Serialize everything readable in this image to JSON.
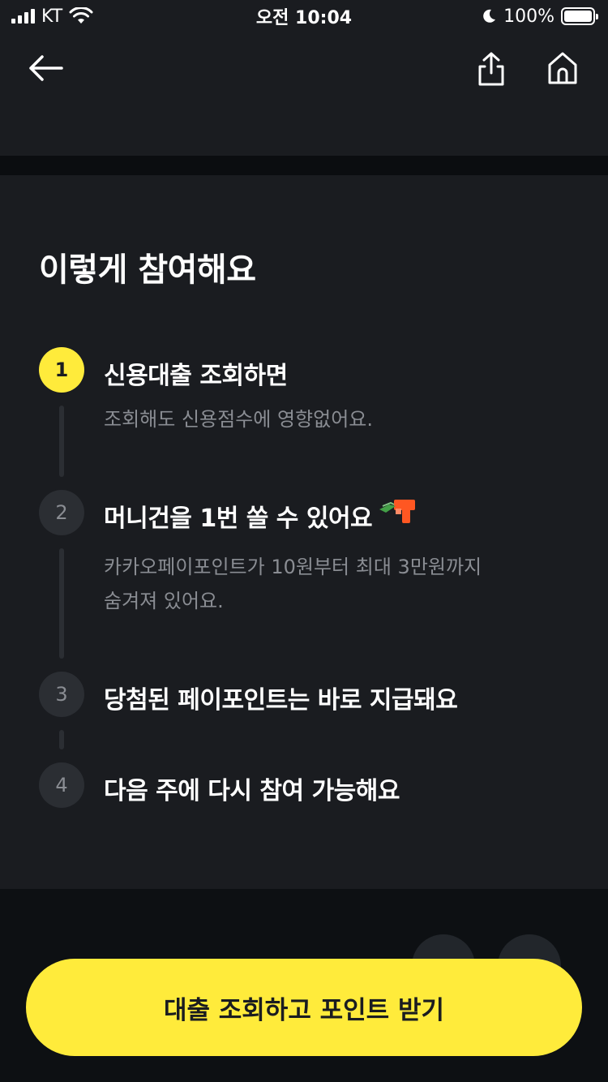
{
  "status_bar": {
    "carrier": "KT",
    "time": "오전 10:04",
    "battery": "100%",
    "icons": [
      "signal-icon",
      "wifi-icon",
      "moon-icon",
      "battery-icon"
    ]
  },
  "nav": {
    "icons": [
      "back-arrow-icon",
      "share-icon",
      "home-icon"
    ]
  },
  "section": {
    "title": "이렇게 참여해요"
  },
  "steps": [
    {
      "number": "1",
      "title": "신용대출 조회하면",
      "description": "조회해도 신용점수에 영향없어요.",
      "active": true
    },
    {
      "number": "2",
      "title": "머니건을 1번 쏠 수 있어요",
      "description_lines": [
        "카카오페이포인트가 10원부터 최대 3만원까지",
        "숨겨져 있어요."
      ],
      "active": false,
      "icon": "money-gun-icon"
    },
    {
      "number": "3",
      "title": "당첨된 페이포인트는 바로 지급돼요",
      "active": false
    },
    {
      "number": "4",
      "title": "다음 주에 다시 참여 가능해요",
      "active": false
    }
  ],
  "cta": {
    "label": "대출 조회하고 포인트 받기"
  },
  "colors": {
    "background": "#1a1c20",
    "accent": "#ffeb3b",
    "muted_text": "#8a8d93"
  }
}
